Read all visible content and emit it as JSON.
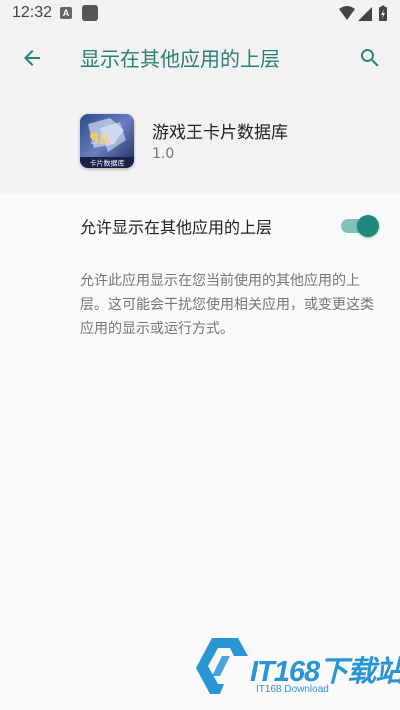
{
  "status_bar": {
    "time": "12:32",
    "a_icon_label": "A"
  },
  "header": {
    "title": "显示在其他应用的上层"
  },
  "app": {
    "name": "游戏王卡片数据库",
    "version": "1.0",
    "icon_caption": "卡片数据库"
  },
  "setting": {
    "label": "允许显示在其他应用的上层",
    "enabled": true
  },
  "description": "允许此应用显示在您当前使用的其他应用的上层。这可能会干扰您使用相关应用，或变更这类应用的显示或运行方式。",
  "watermark": {
    "brand": "IT168下载站",
    "subtitle": "IT168 Download"
  },
  "colors": {
    "accent": "#2a7f74",
    "switch_thumb": "#1f8a7b",
    "switch_track": "#7fc3b9",
    "watermark": "#2a95d4"
  }
}
